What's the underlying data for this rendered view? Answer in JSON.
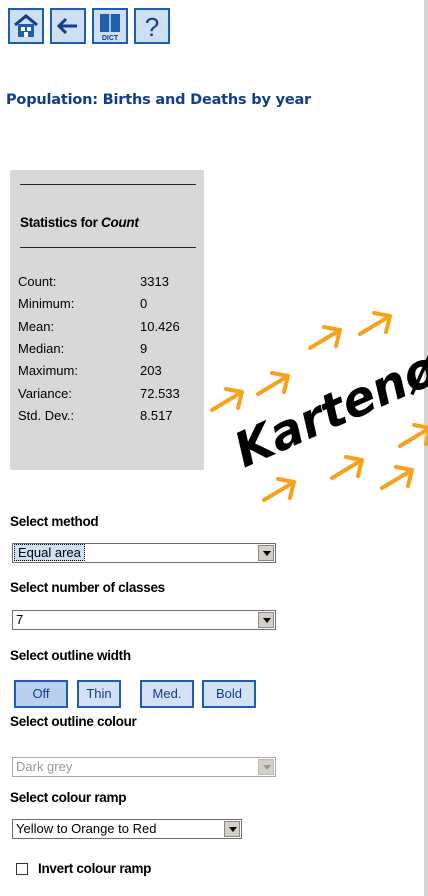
{
  "toolbar": {
    "buttons": [
      {
        "icon": "home-icon"
      },
      {
        "icon": "back-arrow-icon"
      },
      {
        "icon": "dictionary-icon",
        "label": "DICT"
      },
      {
        "icon": "help-icon",
        "label": "?"
      }
    ]
  },
  "page_title": "Population: Births and Deaths by year",
  "stats": {
    "heading_prefix": "Statistics for ",
    "heading_field": "Count",
    "rows": [
      {
        "label": "Count:",
        "value": "3313"
      },
      {
        "label": "Minimum:",
        "value": "0"
      },
      {
        "label": "Mean:",
        "value": "10.426"
      },
      {
        "label": "Median:",
        "value": "9"
      },
      {
        "label": "Maximum:",
        "value": "203"
      },
      {
        "label": "Variance:",
        "value": "72.533"
      },
      {
        "label": "Std. Dev.:",
        "value": "8.517"
      }
    ]
  },
  "overlay": {
    "text": "Kartenø",
    "arrow_color": "#f7a21b"
  },
  "form": {
    "method_label": "Select method",
    "method_value": "Equal area",
    "classes_label": "Select number of classes",
    "classes_value": "7",
    "outline_width_label": "Select outline width",
    "outline_width_options": [
      "Off",
      "Thin",
      "Med.",
      "Bold"
    ],
    "outline_width_selected": "Off",
    "outline_colour_label": "Select outline colour",
    "outline_colour_value": "Dark grey",
    "colour_ramp_label": "Select colour ramp",
    "colour_ramp_value": "Yellow to Orange to Red",
    "invert_label": "Invert colour ramp",
    "invert_checked": false
  },
  "colors": {
    "accent_blue": "#1f5fa9",
    "title_blue": "#123d8f",
    "panel_grey": "#d8d8d8"
  }
}
